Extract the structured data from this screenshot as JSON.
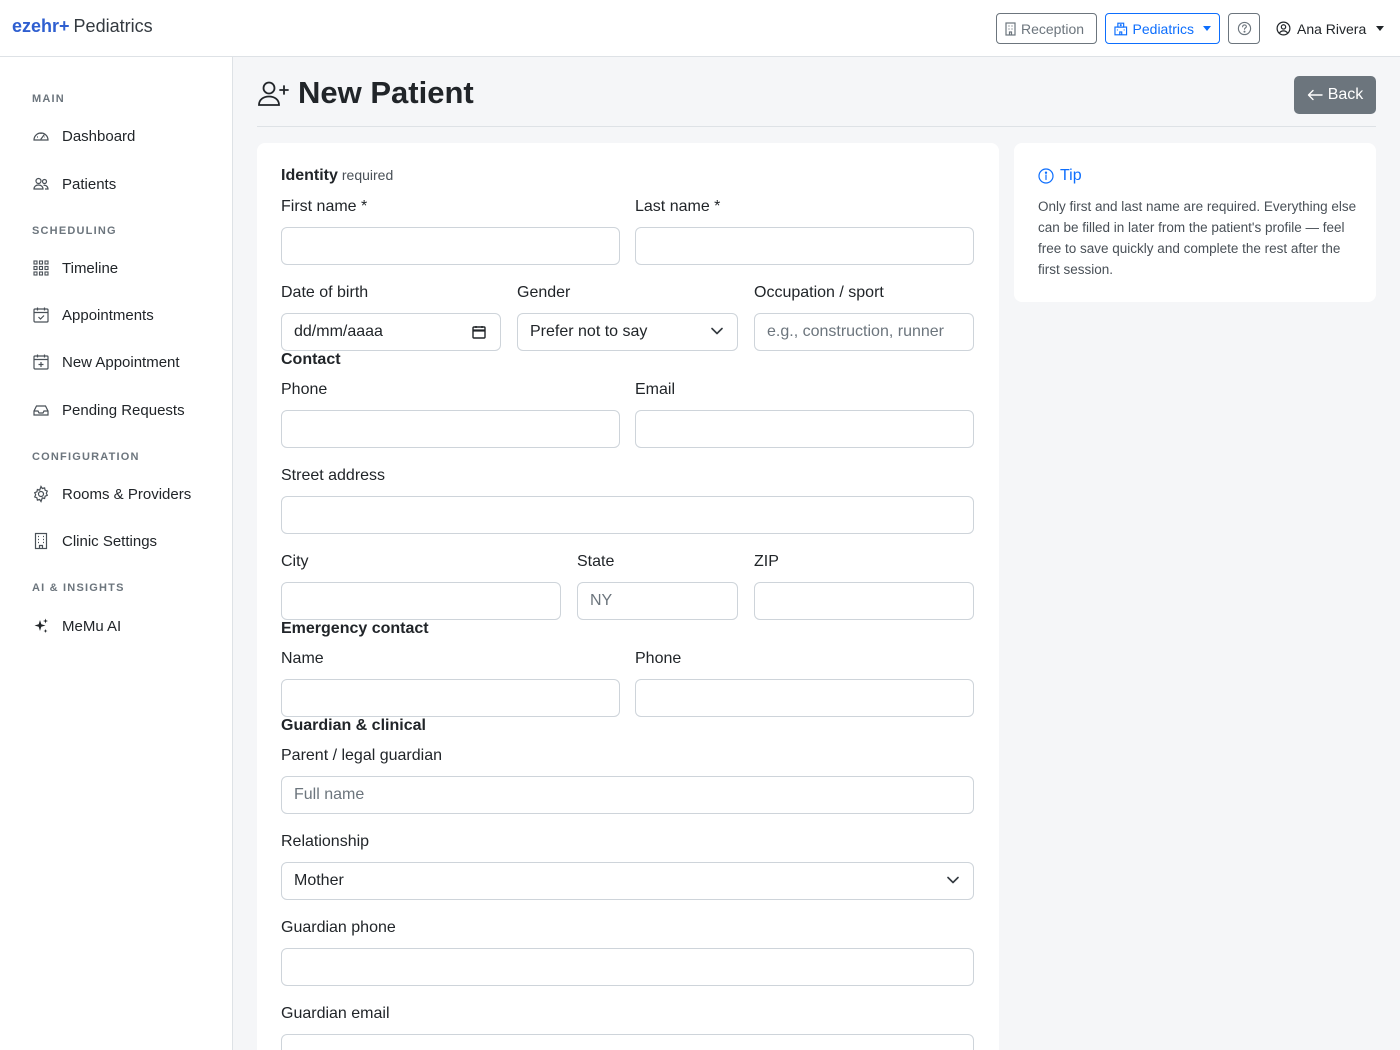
{
  "header": {
    "brand_logo": "ezehr+",
    "brand_sub": "Pediatrics",
    "reception_label": "Reception",
    "clinic_label": "Pediatrics",
    "help_icon": "question-circle-icon",
    "user_name": "Ana Rivera"
  },
  "sidebar": {
    "sections": [
      {
        "title": "MAIN",
        "items": [
          {
            "label": "Dashboard",
            "icon": "speedometer-icon"
          },
          {
            "label": "Patients",
            "icon": "people-icon"
          }
        ]
      },
      {
        "title": "SCHEDULING",
        "items": [
          {
            "label": "Timeline",
            "icon": "grid-icon"
          },
          {
            "label": "Appointments",
            "icon": "calendar-check-icon"
          },
          {
            "label": "New Appointment",
            "icon": "calendar-plus-icon"
          },
          {
            "label": "Pending Requests",
            "icon": "inbox-icon"
          }
        ]
      },
      {
        "title": "CONFIGURATION",
        "items": [
          {
            "label": "Rooms & Providers",
            "icon": "gear-icon"
          },
          {
            "label": "Clinic Settings",
            "icon": "building-icon"
          }
        ]
      },
      {
        "title": "AI & INSIGHTS",
        "items": [
          {
            "label": "MeMu AI",
            "icon": "sparkles-icon"
          }
        ]
      }
    ]
  },
  "page": {
    "title": "New Patient",
    "back_label": "Back"
  },
  "form": {
    "identity": {
      "title": "Identity",
      "required_note": "required",
      "first_name_label": "First name *",
      "first_name_value": "",
      "last_name_label": "Last name *",
      "last_name_value": "",
      "dob_label": "Date of birth",
      "dob_placeholder": "dd/mm/aaaa",
      "gender_label": "Gender",
      "gender_value": "Prefer not to say",
      "occupation_label": "Occupation / sport",
      "occupation_placeholder": "e.g., construction, runner"
    },
    "contact": {
      "title": "Contact",
      "phone_label": "Phone",
      "email_label": "Email",
      "street_label": "Street address",
      "city_label": "City",
      "state_label": "State",
      "state_placeholder": "NY",
      "zip_label": "ZIP"
    },
    "emergency": {
      "title": "Emergency contact",
      "name_label": "Name",
      "phone_label": "Phone"
    },
    "guardian": {
      "title": "Guardian & clinical",
      "guardian_label": "Parent / legal guardian",
      "guardian_placeholder": "Full name",
      "relationship_label": "Relationship",
      "relationship_value": "Mother",
      "guardian_phone_label": "Guardian phone",
      "guardian_email_label": "Guardian email"
    }
  },
  "tip": {
    "title": "Tip",
    "text": "Only first and last name are required. Everything else can be filled in later from the patient's profile — feel free to save quickly and complete the rest after the first session."
  },
  "colors": {
    "brand": "#2f5fd0",
    "primary": "#0d6efd",
    "secondary": "#6c757d",
    "background": "#f5f6f8"
  }
}
